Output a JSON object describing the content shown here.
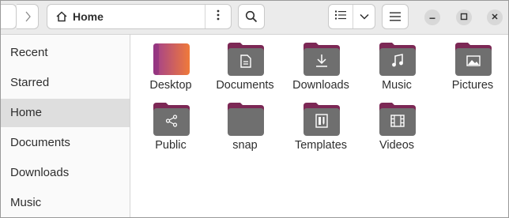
{
  "window": {
    "location_label": "Home",
    "icons": {
      "back": "chevron-left-icon",
      "forward": "chevron-right-icon",
      "home": "home-icon",
      "path_menu": "vertical-dots-icon",
      "search": "search-icon",
      "view": "list-view-icon",
      "view_dropdown": "chevron-down-icon",
      "menu": "hamburger-icon",
      "minimize": "minimize-icon",
      "maximize": "maximize-icon",
      "close": "close-icon"
    }
  },
  "sidebar": {
    "items": [
      {
        "label": "Recent"
      },
      {
        "label": "Starred"
      },
      {
        "label": "Home",
        "active": true
      },
      {
        "label": "Documents"
      },
      {
        "label": "Downloads"
      },
      {
        "label": "Music"
      }
    ]
  },
  "files": [
    {
      "label": "Desktop",
      "icon": "desktop-folder-icon"
    },
    {
      "label": "Documents",
      "icon": "documents-folder-icon"
    },
    {
      "label": "Downloads",
      "icon": "downloads-folder-icon"
    },
    {
      "label": "Music",
      "icon": "music-folder-icon"
    },
    {
      "label": "Pictures",
      "icon": "pictures-folder-icon"
    },
    {
      "label": "Public",
      "icon": "public-folder-icon"
    },
    {
      "label": "snap",
      "icon": "folder-icon"
    },
    {
      "label": "Templates",
      "icon": "templates-folder-icon"
    },
    {
      "label": "Videos",
      "icon": "videos-folder-icon"
    }
  ],
  "colors": {
    "folder_tab": "#7c2855",
    "folder_body": "#6f6f6f",
    "desktop_gradient_start": "#a03f8f",
    "desktop_gradient_end": "#f07a3a",
    "header_bg": "#ebebeb"
  }
}
